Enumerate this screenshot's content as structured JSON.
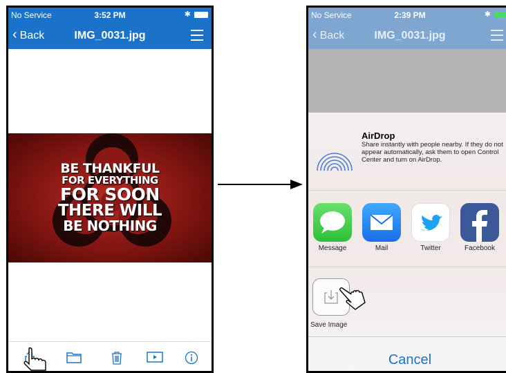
{
  "left_screen": {
    "status": {
      "carrier": "No Service",
      "time": "3:52 PM"
    },
    "nav": {
      "back_label": "Back",
      "title": "IMG_0031.jpg"
    },
    "poster_lines": [
      "BE THANKFUL",
      "FOR EVERYTHING",
      "FOR SOON",
      "THERE WILL",
      "BE NOTHING"
    ],
    "toolbar_icons": [
      "share-icon",
      "folder-icon",
      "trash-icon",
      "play-icon",
      "info-icon"
    ]
  },
  "right_screen": {
    "status": {
      "carrier": "No Service",
      "time": "2:39 PM"
    },
    "nav": {
      "back_label": "Back",
      "title": "IMG_0031.jpg"
    },
    "airdrop": {
      "title": "AirDrop",
      "description": "Share instantly with people nearby. If they do not appear automatically, ask them to open Control Center and turn on AirDrop."
    },
    "share_apps": [
      {
        "label": "Message",
        "color": "#4cd964"
      },
      {
        "label": "Mail",
        "color": "#1e88ff"
      },
      {
        "label": "Twitter",
        "color": "#ffffff"
      },
      {
        "label": "Facebook",
        "color": "#3b5998"
      }
    ],
    "actions": [
      {
        "label": "Save Image"
      }
    ],
    "cancel_label": "Cancel"
  },
  "colors": {
    "accent": "#1a73c8"
  }
}
